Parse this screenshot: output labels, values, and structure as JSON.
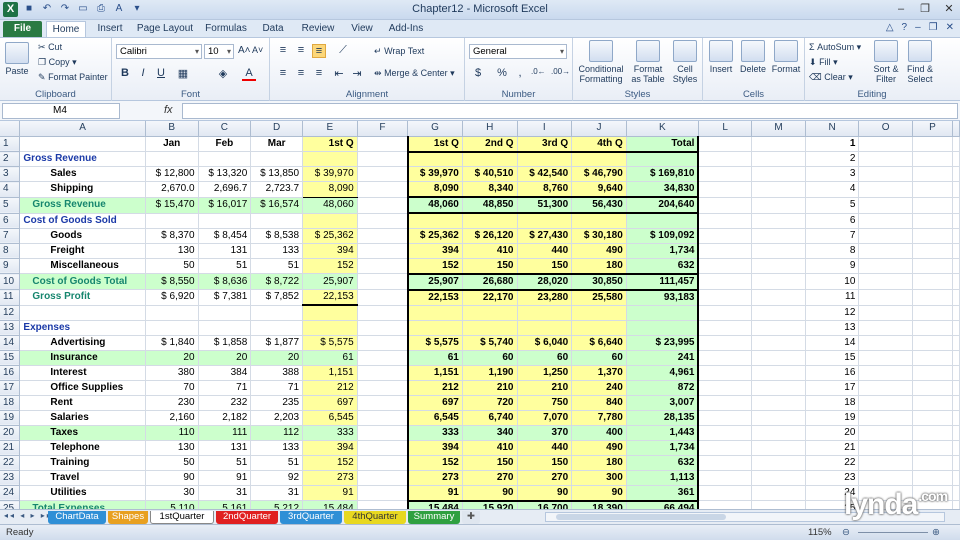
{
  "window": {
    "title": "Chapter12 - Microsoft Excel"
  },
  "qat_icons": [
    "save-icon",
    "undo-icon",
    "redo-icon",
    "open-icon",
    "print-preview-icon",
    "font-color-icon",
    "customize-icon"
  ],
  "ribbon_tabs": [
    "File",
    "Home",
    "Insert",
    "Page Layout",
    "Formulas",
    "Data",
    "Review",
    "View",
    "Add-Ins"
  ],
  "ribbon": {
    "clipboard": {
      "label": "Clipboard",
      "paste": "Paste",
      "cut": "Cut",
      "copy": "Copy",
      "format_painter": "Format Painter"
    },
    "font": {
      "label": "Font",
      "name": "Calibri",
      "size": "10",
      "bold": "B",
      "italic": "I",
      "underline": "U"
    },
    "alignment": {
      "label": "Alignment",
      "wrap": "Wrap Text",
      "merge": "Merge & Center"
    },
    "number": {
      "label": "Number",
      "format": "General",
      "currency": "$",
      "percent": "%",
      "comma": ","
    },
    "styles": {
      "label": "Styles",
      "cond_line1": "Conditional",
      "cond_line2": "Formatting",
      "fmt_line1": "Format",
      "fmt_line2": "as Table",
      "cell_line1": "Cell",
      "cell_line2": "Styles"
    },
    "cells": {
      "label": "Cells",
      "insert": "Insert",
      "delete": "Delete",
      "format": "Format"
    },
    "editing": {
      "label": "Editing",
      "autosum": "AutoSum",
      "fill": "Fill",
      "clear": "Clear",
      "sort_line1": "Sort &",
      "sort_line2": "Filter",
      "find_line1": "Find &",
      "find_line2": "Select"
    }
  },
  "formula_bar": {
    "name_box": "M4",
    "fx": "fx",
    "formula": ""
  },
  "columns": [
    "A",
    "B",
    "C",
    "D",
    "E",
    "F",
    "G",
    "H",
    "I",
    "J",
    "K",
    "L",
    "M",
    "N",
    "O",
    "P"
  ],
  "rows": [
    {
      "n": "1",
      "a": "",
      "b": "Jan",
      "c": "Feb",
      "d": "Mar",
      "e": "1st Q",
      "g": "1st Q",
      "h": "2nd Q",
      "i": "3rd Q",
      "j": "4th Q",
      "k": "Total",
      "type": "hdr"
    },
    {
      "n": "2",
      "a": "Gross Revenue",
      "type": "sec"
    },
    {
      "n": "3",
      "a": "Sales",
      "b": "$ 12,800",
      "c": "$ 13,320",
      "d": "$ 13,850",
      "e": "$ 39,970",
      "g": "$ 39,970",
      "h": "$ 40,510",
      "i": "$ 42,540",
      "j": "$ 46,790",
      "k": "$ 169,810",
      "type": "item"
    },
    {
      "n": "4",
      "a": "Shipping",
      "b": "2,670.0",
      "c": "2,696.7",
      "d": "2,723.7",
      "e": "8,090",
      "g": "8,090",
      "h": "8,340",
      "i": "8,760",
      "j": "9,640",
      "k": "34,830",
      "type": "item"
    },
    {
      "n": "5",
      "a": "Gross Revenue",
      "b": "$ 15,470",
      "c": "$ 16,017",
      "d": "$ 16,574",
      "e": "48,060",
      "g": "48,060",
      "h": "48,850",
      "i": "51,300",
      "j": "56,430",
      "k": "204,640",
      "type": "total"
    },
    {
      "n": "6",
      "a": "Cost of Goods Sold",
      "type": "sec"
    },
    {
      "n": "7",
      "a": "Goods",
      "b": "$ 8,370",
      "c": "$ 8,454",
      "d": "$ 8,538",
      "e": "$ 25,362",
      "g": "$ 25,362",
      "h": "$ 26,120",
      "i": "$ 27,430",
      "j": "$ 30,180",
      "k": "$ 109,092",
      "type": "item"
    },
    {
      "n": "8",
      "a": "Freight",
      "b": "130",
      "c": "131",
      "d": "133",
      "e": "394",
      "g": "394",
      "h": "410",
      "i": "440",
      "j": "490",
      "k": "1,734",
      "type": "item"
    },
    {
      "n": "9",
      "a": "Miscellaneous",
      "b": "50",
      "c": "51",
      "d": "51",
      "e": "152",
      "g": "152",
      "h": "150",
      "i": "150",
      "j": "180",
      "k": "632",
      "type": "item"
    },
    {
      "n": "10",
      "a": "Cost of Goods Total",
      "b": "$ 8,550",
      "c": "$ 8,636",
      "d": "$ 8,722",
      "e": "25,907",
      "g": "25,907",
      "h": "26,680",
      "i": "28,020",
      "j": "30,850",
      "k": "111,457",
      "type": "total"
    },
    {
      "n": "11",
      "a": "Gross Profit",
      "b": "$ 6,920",
      "c": "$ 7,381",
      "d": "$ 7,852",
      "e": "22,153",
      "g": "22,153",
      "h": "22,170",
      "i": "23,280",
      "j": "25,580",
      "k": "93,183",
      "type": "profit"
    },
    {
      "n": "12",
      "type": "blank"
    },
    {
      "n": "13",
      "a": "Expenses",
      "type": "sec"
    },
    {
      "n": "14",
      "a": "Advertising",
      "b": "$ 1,840",
      "c": "$ 1,858",
      "d": "$ 1,877",
      "e": "$ 5,575",
      "g": "$ 5,575",
      "h": "$ 5,740",
      "i": "$ 6,040",
      "j": "$ 6,640",
      "k": "$ 23,995",
      "type": "exp"
    },
    {
      "n": "15",
      "a": "Insurance",
      "b": "20",
      "c": "20",
      "d": "20",
      "e": "61",
      "g": "61",
      "h": "60",
      "i": "60",
      "j": "60",
      "k": "241",
      "type": "expg"
    },
    {
      "n": "16",
      "a": "Interest",
      "b": "380",
      "c": "384",
      "d": "388",
      "e": "1,151",
      "g": "1,151",
      "h": "1,190",
      "i": "1,250",
      "j": "1,370",
      "k": "4,961",
      "type": "exp"
    },
    {
      "n": "17",
      "a": "Office Supplies",
      "b": "70",
      "c": "71",
      "d": "71",
      "e": "212",
      "g": "212",
      "h": "210",
      "i": "210",
      "j": "240",
      "k": "872",
      "type": "exp"
    },
    {
      "n": "18",
      "a": "Rent",
      "b": "230",
      "c": "232",
      "d": "235",
      "e": "697",
      "g": "697",
      "h": "720",
      "i": "750",
      "j": "840",
      "k": "3,007",
      "type": "exp"
    },
    {
      "n": "19",
      "a": "Salaries",
      "b": "2,160",
      "c": "2,182",
      "d": "2,203",
      "e": "6,545",
      "g": "6,545",
      "h": "6,740",
      "i": "7,070",
      "j": "7,780",
      "k": "28,135",
      "type": "exp"
    },
    {
      "n": "20",
      "a": "Taxes",
      "b": "110",
      "c": "111",
      "d": "112",
      "e": "333",
      "g": "333",
      "h": "340",
      "i": "370",
      "j": "400",
      "k": "1,443",
      "type": "expg"
    },
    {
      "n": "21",
      "a": "Telephone",
      "b": "130",
      "c": "131",
      "d": "133",
      "e": "394",
      "g": "394",
      "h": "410",
      "i": "440",
      "j": "490",
      "k": "1,734",
      "type": "exp"
    },
    {
      "n": "22",
      "a": "Training",
      "b": "50",
      "c": "51",
      "d": "51",
      "e": "152",
      "g": "152",
      "h": "150",
      "i": "150",
      "j": "180",
      "k": "632",
      "type": "exp"
    },
    {
      "n": "23",
      "a": "Travel",
      "b": "90",
      "c": "91",
      "d": "92",
      "e": "273",
      "g": "273",
      "h": "270",
      "i": "270",
      "j": "300",
      "k": "1,113",
      "type": "exp"
    },
    {
      "n": "24",
      "a": "Utilities",
      "b": "30",
      "c": "31",
      "d": "31",
      "e": "91",
      "g": "91",
      "h": "90",
      "i": "90",
      "j": "90",
      "k": "361",
      "type": "exp"
    },
    {
      "n": "25",
      "a": "Total Expenses",
      "b": "5,110",
      "c": "5,161",
      "d": "5,212",
      "e": "15,484",
      "g": "15,484",
      "h": "15,920",
      "i": "16,700",
      "j": "18,390",
      "k": "66,494",
      "type": "total"
    }
  ],
  "sheet_tabs": [
    {
      "name": "ChartData",
      "color": "#2f8fd6"
    },
    {
      "name": "Shapes",
      "color": "#e8a020"
    },
    {
      "name": "1stQuarter",
      "color": "#ffffff",
      "active": true
    },
    {
      "name": "2ndQuarter",
      "color": "#e02020"
    },
    {
      "name": "3rdQuarter",
      "color": "#2f8fd6"
    },
    {
      "name": "4thQuarter",
      "color": "#e8d820"
    },
    {
      "name": "Summary",
      "color": "#2fa040"
    }
  ],
  "status": {
    "ready": "Ready",
    "zoom": "115%"
  },
  "watermark": "lynda.com"
}
